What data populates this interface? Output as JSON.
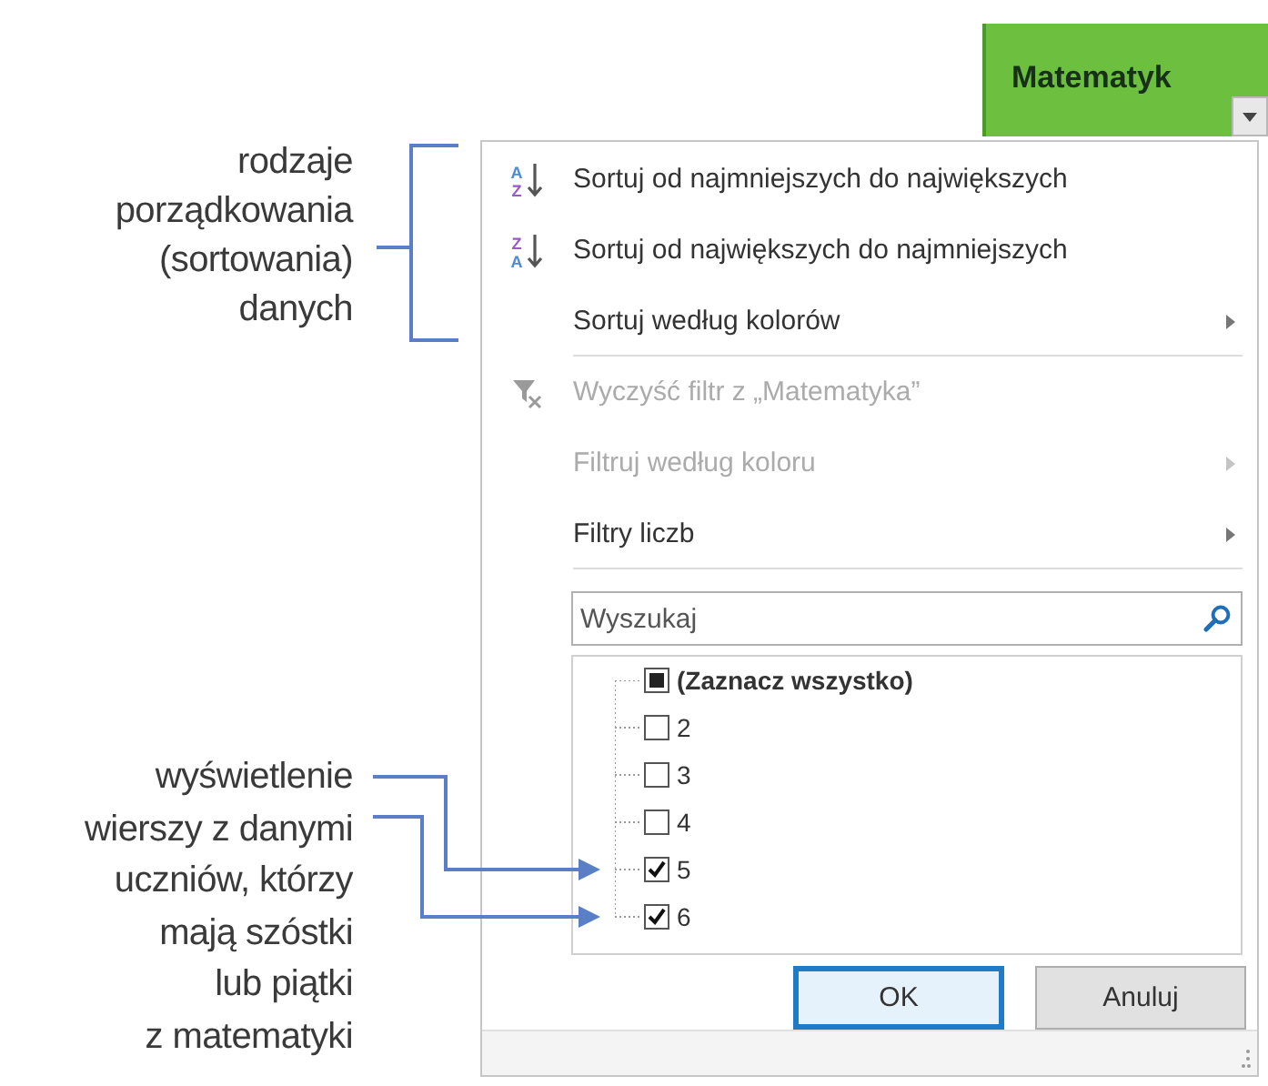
{
  "annotations": [
    {
      "text": "rodzaje\nporządkowania\n(sortowania)\ndanych"
    },
    {
      "text": "wyświetlenie\nwierszy z danymi\nuczniów, którzy\nmają szóstki\nlub piątki\nz matematyki"
    }
  ],
  "column_header": {
    "label": "Matematyk"
  },
  "menu": [
    {
      "label": "Sortuj od najmniejszych do największych",
      "icon": {
        "kind": "sort-asc",
        "top": "A",
        "bottom": "Z"
      },
      "disabled": false,
      "submenu": false,
      "separator_after": false
    },
    {
      "label": "Sortuj od największych do najmniejszych",
      "icon": {
        "kind": "sort-desc",
        "top": "Z",
        "bottom": "A"
      },
      "disabled": false,
      "submenu": false,
      "separator_after": false
    },
    {
      "label": "Sortuj według kolorów",
      "disabled": false,
      "submenu": true,
      "separator_after": true
    },
    {
      "label": "Wyczyść filtr z „Matematyka”",
      "icon": {
        "kind": "clear-filter"
      },
      "disabled": true,
      "submenu": false,
      "separator_after": false
    },
    {
      "label": "Filtruj według koloru",
      "disabled": true,
      "submenu": true,
      "separator_after": false
    },
    {
      "label": "Filtry liczb",
      "disabled": false,
      "submenu": true,
      "separator_after": true
    }
  ],
  "search": {
    "placeholder": "Wyszukaj"
  },
  "values": [
    {
      "label": "(Zaznacz wszystko)",
      "checked": false,
      "indeterminate": true
    },
    {
      "label": "2",
      "checked": false,
      "indeterminate": false
    },
    {
      "label": "3",
      "checked": false,
      "indeterminate": false
    },
    {
      "label": "4",
      "checked": false,
      "indeterminate": false
    },
    {
      "label": "5",
      "checked": true,
      "indeterminate": false
    },
    {
      "label": "6",
      "checked": true,
      "indeterminate": false
    }
  ],
  "buttons": [
    {
      "label": "OK",
      "kind": "default"
    },
    {
      "label": "Anuluj",
      "kind": "normal"
    }
  ]
}
